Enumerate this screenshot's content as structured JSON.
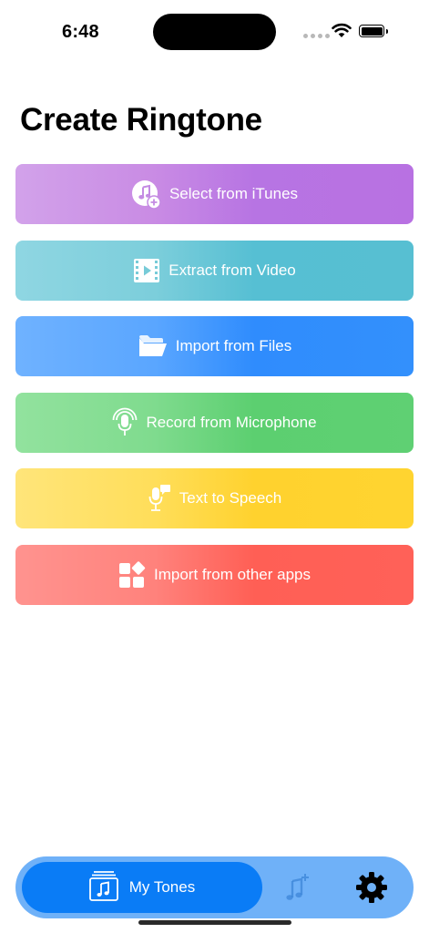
{
  "status_bar": {
    "time": "6:48"
  },
  "page_title": "Create Ringtone",
  "options": [
    {
      "label": "Select from iTunes",
      "icon": "music-note-add-icon"
    },
    {
      "label": "Extract from Video",
      "icon": "video-film-icon"
    },
    {
      "label": "Import from Files",
      "icon": "folder-icon"
    },
    {
      "label": "Record from Microphone",
      "icon": "microphone-waves-icon"
    },
    {
      "label": "Text to Speech",
      "icon": "speech-microphone-icon"
    },
    {
      "label": "Import from other apps",
      "icon": "app-grid-icon"
    }
  ],
  "tab_bar": {
    "active_label": "My Tones",
    "tabs": [
      {
        "icon": "music-tones-icon",
        "active": true
      },
      {
        "icon": "music-add-icon",
        "active": false
      },
      {
        "icon": "gear-icon",
        "active": false
      }
    ],
    "accent_color": "#0a7cf6"
  }
}
